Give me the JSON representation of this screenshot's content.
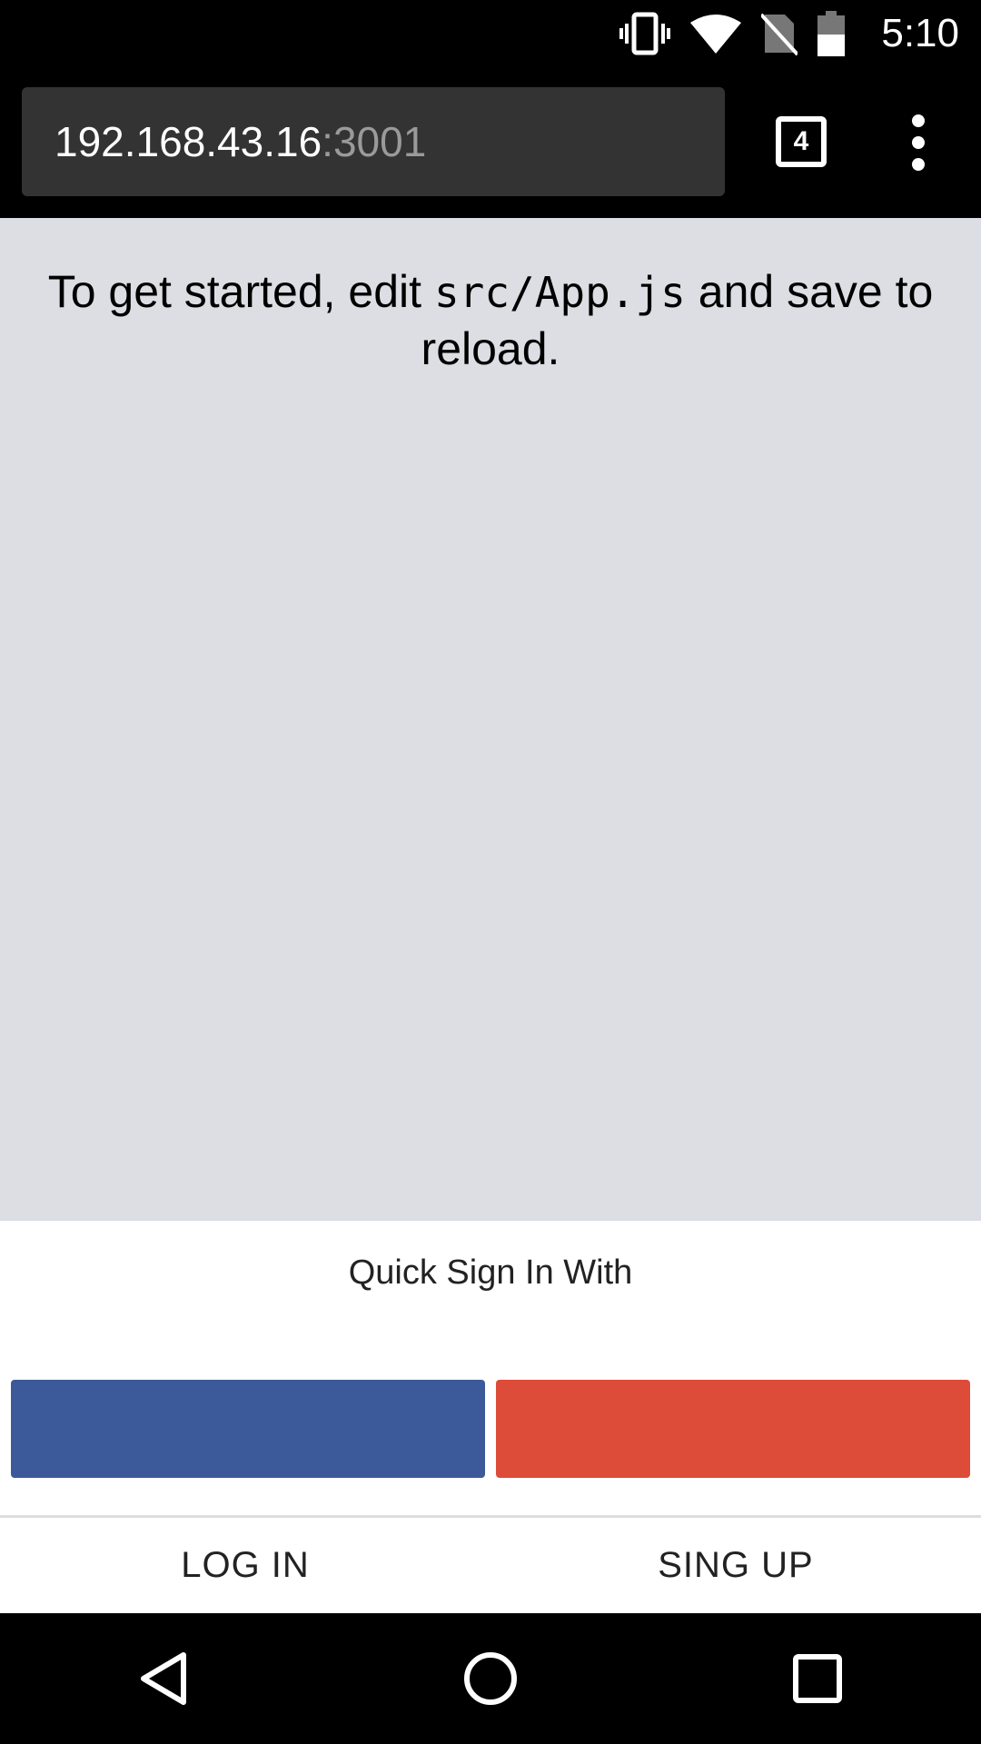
{
  "status_bar": {
    "time": "5:10",
    "icons": [
      "vibrate-icon",
      "wifi-icon",
      "no-sim-icon",
      "battery-icon"
    ]
  },
  "browser": {
    "url_host": "192.168.43.16",
    "url_port": ":3001",
    "tab_count": "4",
    "icons": [
      "tabs-icon",
      "overflow-menu-icon"
    ]
  },
  "page": {
    "intro_prefix": "To get started, edit ",
    "intro_code": "src/App.js",
    "intro_suffix": " and save to reload."
  },
  "signin": {
    "title": "Quick Sign In With",
    "facebook_color": "#3c5a99",
    "google_color": "#dd4b39",
    "login_label": "LOG IN",
    "signup_label": "SING UP"
  },
  "navbar": {
    "icons": [
      "back-icon",
      "home-icon",
      "recents-icon"
    ]
  }
}
